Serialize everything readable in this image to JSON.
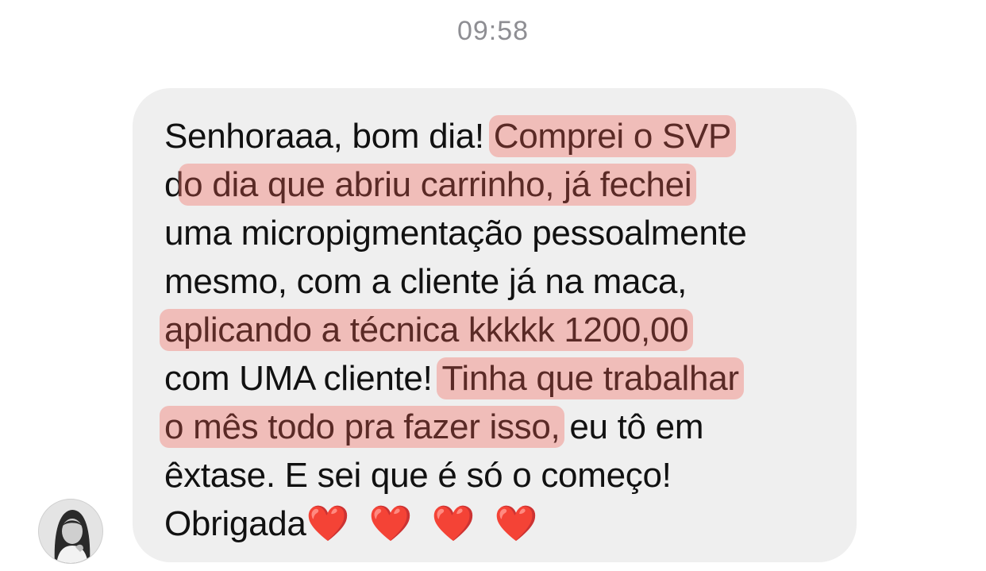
{
  "timestamp": "09:58",
  "message": {
    "lines": [
      {
        "parts": [
          {
            "text": "Senhoraaa, bom dia! ",
            "highlight": false
          },
          {
            "text": "Comprei o SVP",
            "highlight": true
          }
        ]
      },
      {
        "parts": [
          {
            "text": "d",
            "highlight": false
          },
          {
            "text": "o dia que abriu carrinho, já fechei",
            "highlight": true
          }
        ]
      },
      {
        "parts": [
          {
            "text": "uma micropigmentação pessoalmente",
            "highlight": false
          }
        ]
      },
      {
        "parts": [
          {
            "text": "mesmo, com a cliente já na maca,",
            "highlight": false
          }
        ]
      },
      {
        "parts": [
          {
            "text": "aplicando a técnica kkkkk 1200,00",
            "highlight": true
          }
        ]
      },
      {
        "parts": [
          {
            "text": "com UMA cliente! ",
            "highlight": false
          },
          {
            "text": "Tinha que trabalhar",
            "highlight": true
          }
        ]
      },
      {
        "parts": [
          {
            "text": "o mês todo pra fazer isso,",
            "highlight": true
          },
          {
            "text": " eu tô em",
            "highlight": false
          }
        ]
      },
      {
        "parts": [
          {
            "text": "êxtase. E sei que é só o começo!",
            "highlight": false
          }
        ]
      },
      {
        "parts": [
          {
            "text": "Obrigada",
            "highlight": false
          },
          {
            "text": "❤️ ❤️ ❤️ ❤️",
            "highlight": false,
            "emoji": true
          }
        ]
      }
    ]
  },
  "colors": {
    "bubble": "#efefef",
    "highlight": "#f0786e",
    "heart": "#e02020",
    "timestamp": "#8e8e93"
  },
  "avatar": {
    "icon": "profile-photo"
  }
}
